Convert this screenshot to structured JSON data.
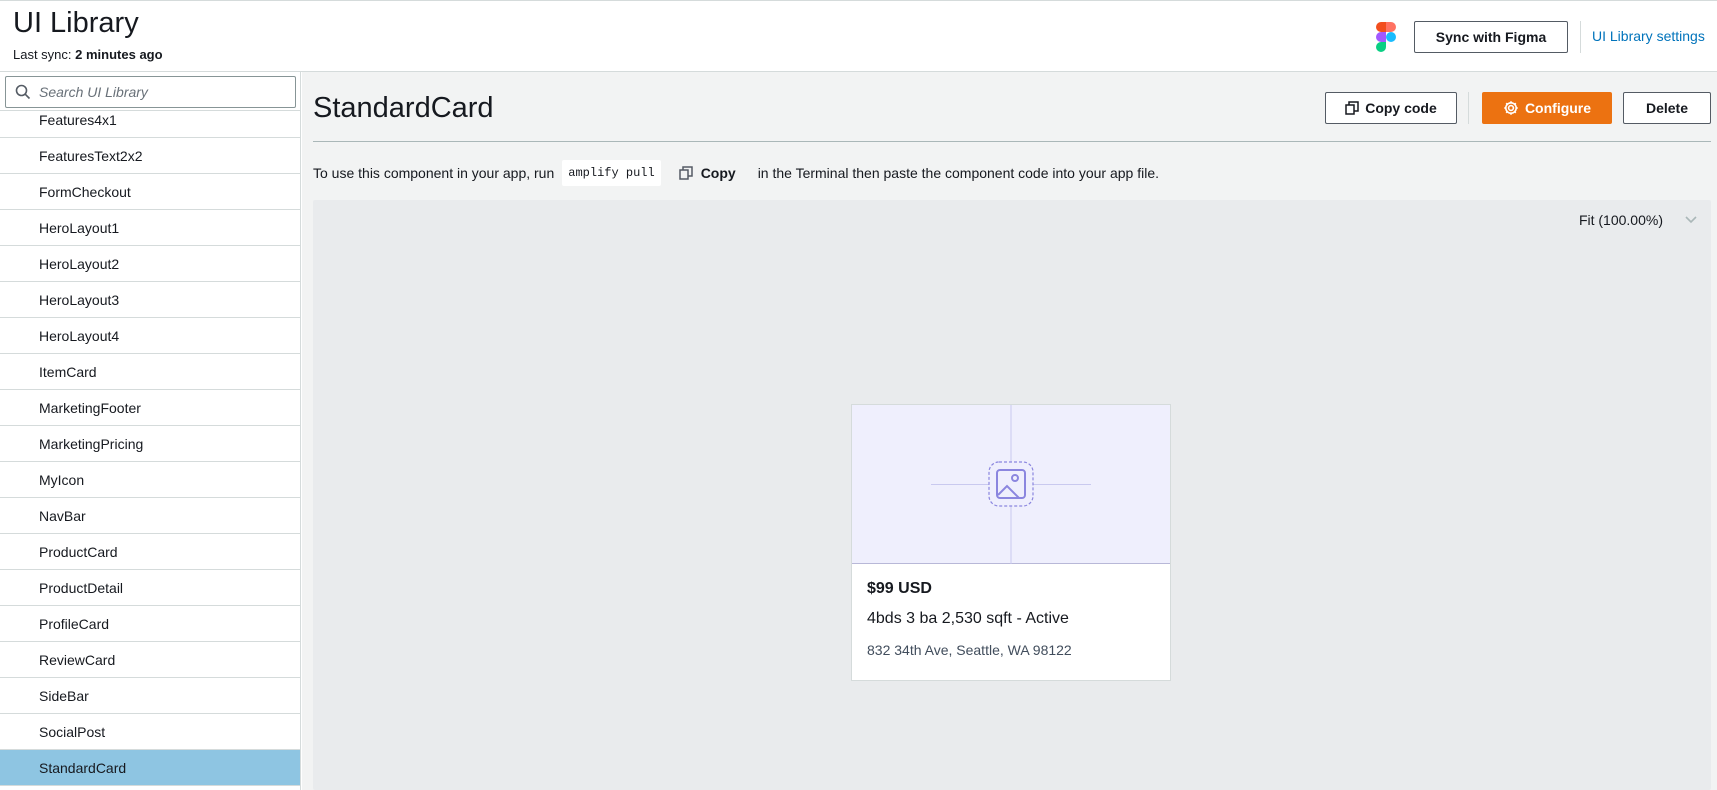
{
  "header": {
    "title": "UI Library",
    "last_sync_label": "Last sync:",
    "last_sync_value": "2 minutes ago",
    "sync_button": "Sync with Figma",
    "settings_link": "UI Library settings"
  },
  "sidebar": {
    "search_placeholder": "Search UI Library",
    "items": [
      "Features4x1",
      "FeaturesText2x2",
      "FormCheckout",
      "HeroLayout1",
      "HeroLayout2",
      "HeroLayout3",
      "HeroLayout4",
      "ItemCard",
      "MarketingFooter",
      "MarketingPricing",
      "MyIcon",
      "NavBar",
      "ProductCard",
      "ProductDetail",
      "ProfileCard",
      "ReviewCard",
      "SideBar",
      "SocialPost",
      "StandardCard"
    ],
    "selected": "StandardCard"
  },
  "main": {
    "title": "StandardCard",
    "copy_code_button": "Copy code",
    "configure_button": "Configure",
    "delete_button": "Delete",
    "instructions_prefix": "To use this component in your app, run",
    "command": "amplify pull",
    "copy_label": "Copy",
    "instructions_suffix": "in the Terminal then paste the component code into your app file.",
    "zoom": "Fit (100.00%)"
  },
  "card": {
    "price": "$99 USD",
    "details": "4bds 3 ba 2,530 sqft - Active",
    "address": "832 34th Ave, Seattle, WA 98122"
  },
  "colors": {
    "accent": "#ec7211",
    "link": "#0073bb",
    "selected_row": "#8ec5e2",
    "placeholder_bg": "#efeffd"
  }
}
